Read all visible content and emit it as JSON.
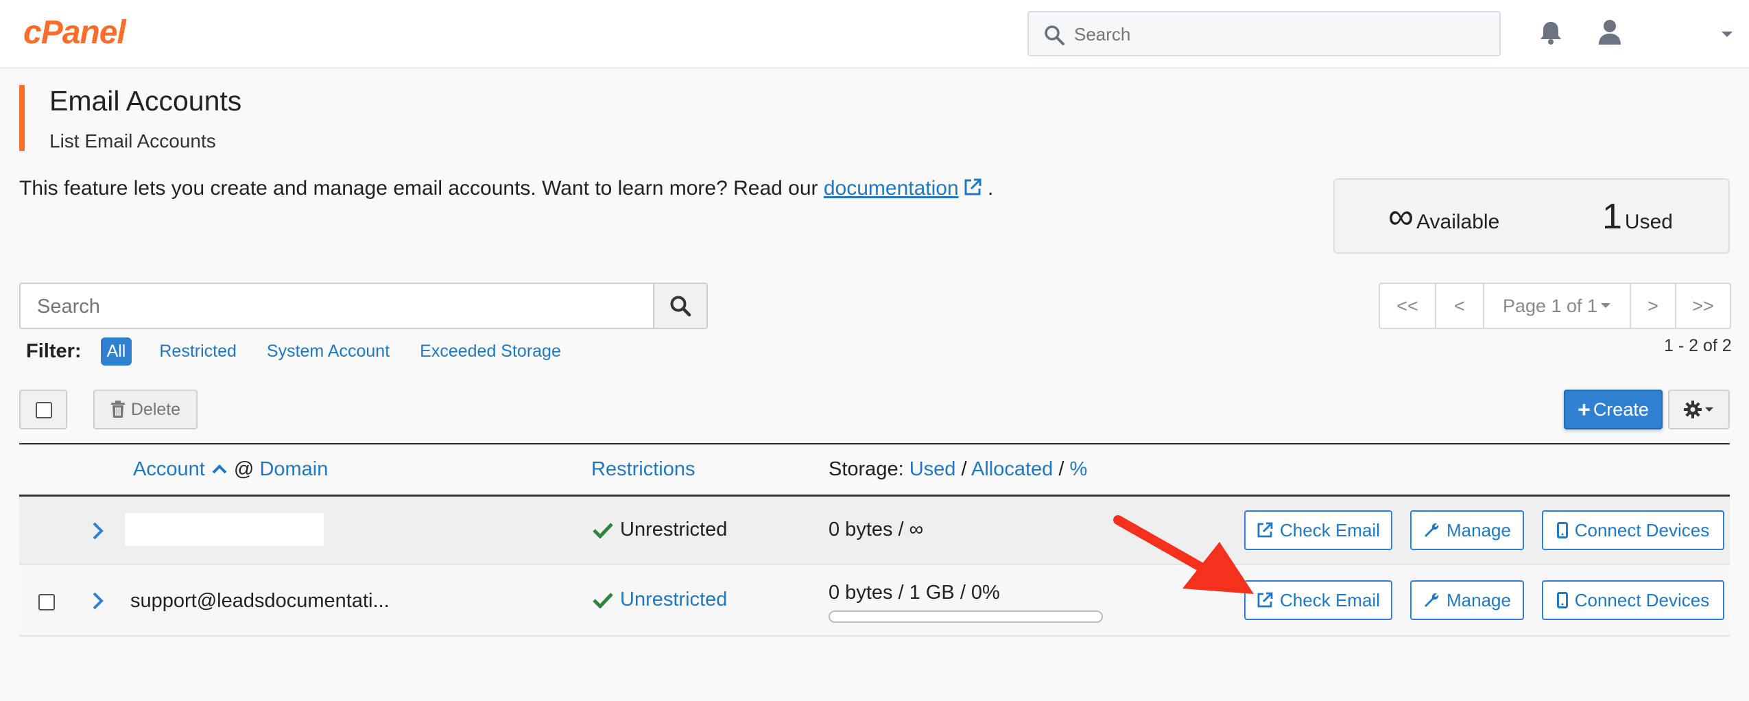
{
  "header": {
    "logo": "cPanel",
    "search_placeholder": "Search"
  },
  "page": {
    "title": "Email Accounts",
    "subtitle": "List Email Accounts",
    "intro_text": "This feature lets you create and manage email accounts. Want to learn more? Read our",
    "intro_link": "documentation",
    "intro_end": "."
  },
  "stats": {
    "available_value": "∞",
    "available_label": "Available",
    "used_value": "1",
    "used_label": "Used"
  },
  "search": {
    "placeholder": "Search"
  },
  "filter": {
    "label": "Filter:",
    "options": [
      "All",
      "Restricted",
      "System Account",
      "Exceeded Storage"
    ],
    "selected": "All"
  },
  "pagination": {
    "first": "<<",
    "prev": "<",
    "page_label": "Page 1 of 1",
    "next": ">",
    "last": ">>",
    "count": "1 - 2 of 2"
  },
  "actions": {
    "delete_label": "Delete",
    "create_label": "Create"
  },
  "table": {
    "headers": {
      "account": "Account",
      "at": "@",
      "domain": "Domain",
      "restrictions": "Restrictions",
      "storage_prefix": "Storage:",
      "used": "Used",
      "allocated": "Allocated",
      "percent": "%",
      "sep": "/"
    },
    "rows": [
      {
        "account": "",
        "restriction": "Unrestricted",
        "storage": "0 bytes / ∞",
        "check_email": "Check Email",
        "manage": "Manage",
        "connect": "Connect Devices"
      },
      {
        "account": "support@leadsdocumentati...",
        "restriction": "Unrestricted",
        "storage": "0 bytes / 1 GB / 0%",
        "usage_percent": 0,
        "check_email": "Check Email",
        "manage": "Manage",
        "connect": "Connect Devices"
      }
    ]
  },
  "colors": {
    "brand": "#ff6c2c",
    "primary": "#2f80d0",
    "success": "#2e8540",
    "annotation_arrow": "#f5301d"
  }
}
